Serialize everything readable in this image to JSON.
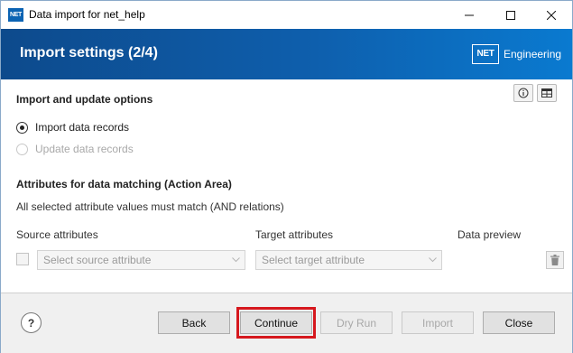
{
  "window": {
    "title": "Data import for net_help",
    "app_icon_text": "NET"
  },
  "banner": {
    "title": "Import settings (2/4)",
    "brand_box": "NET",
    "brand_text": "Engineering"
  },
  "import_options": {
    "heading": "Import and update options",
    "options": [
      {
        "label": "Import data records",
        "selected": true,
        "enabled": true
      },
      {
        "label": "Update data records",
        "selected": false,
        "enabled": false
      }
    ]
  },
  "matching": {
    "heading": "Attributes for data matching (Action Area)",
    "description": "All selected attribute values must match (AND relations)",
    "columns": {
      "source": "Source attributes",
      "target": "Target attributes",
      "preview": "Data preview"
    },
    "row": {
      "source_placeholder": "Select source attribute",
      "target_placeholder": "Select target attribute"
    }
  },
  "footer": {
    "help_label": "?",
    "buttons": {
      "back": "Back",
      "continue": "Continue",
      "dry_run": "Dry Run",
      "import": "Import",
      "close": "Close"
    }
  },
  "icons": {
    "minimize": "minimize-icon",
    "maximize": "maximize-icon",
    "close": "close-icon",
    "info": "info-icon",
    "table": "table-icon",
    "trash": "trash-icon",
    "chevron": "chevron-down-icon"
  },
  "colors": {
    "banner_start": "#0d4a8c",
    "banner_end": "#0a7ad0",
    "highlight": "#d6181e"
  }
}
